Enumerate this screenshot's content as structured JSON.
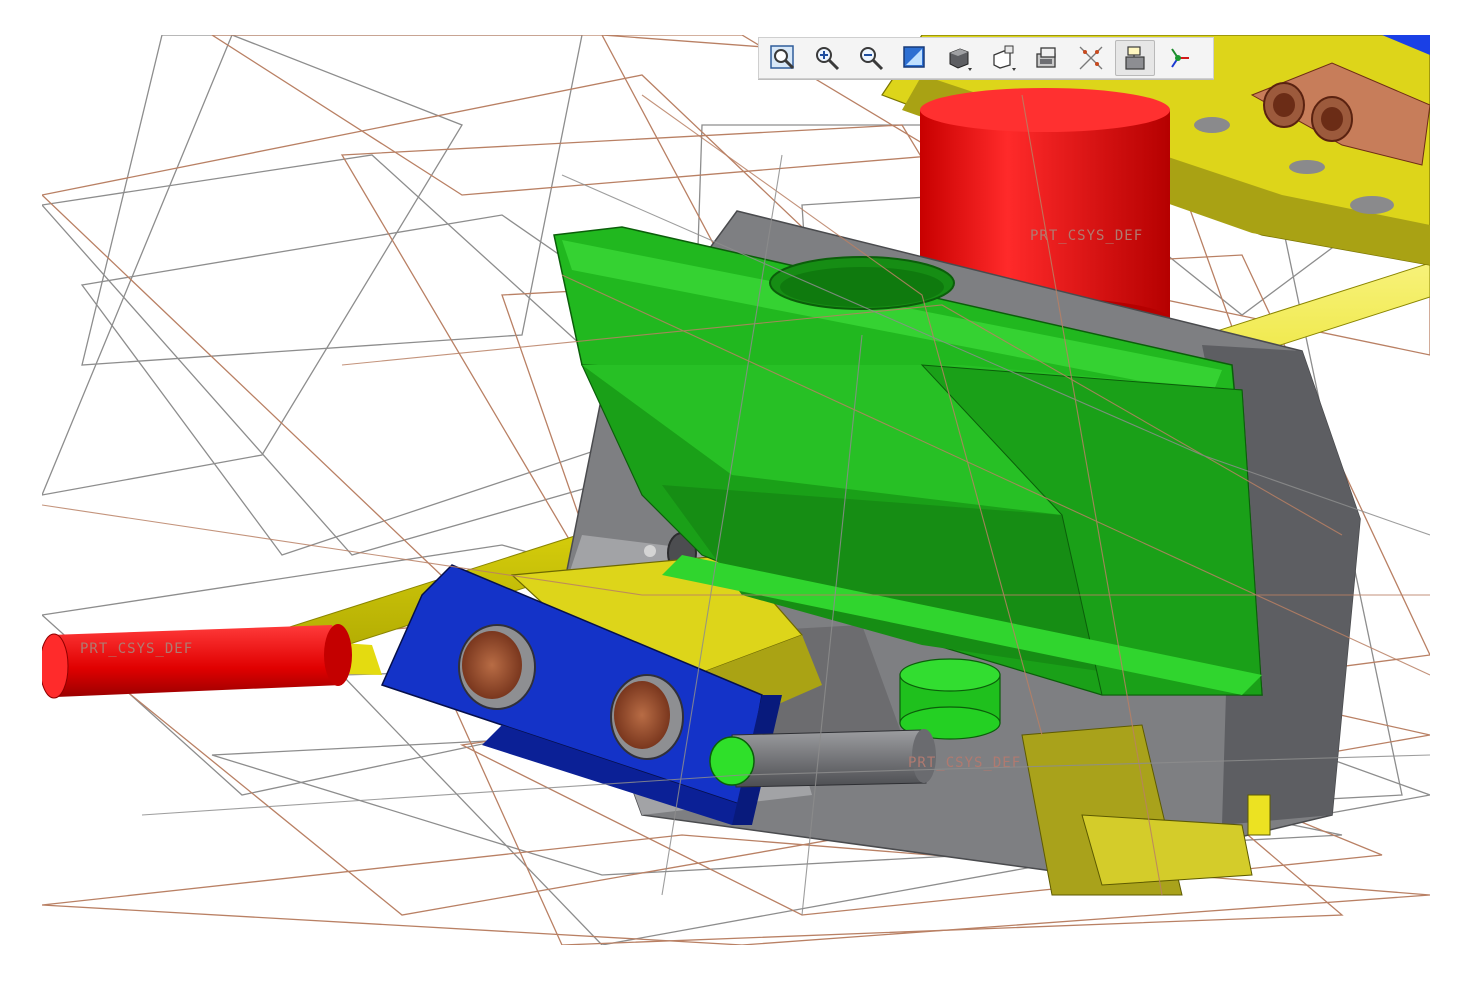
{
  "window": {
    "title": ""
  },
  "viewport": {
    "csys_labels": {
      "cylinder_top": "PRT_CSYS_DEF",
      "cylinder_left": "PRT_CSYS_DEF",
      "pin_bottom": "PRT_CSYS_DEF"
    },
    "colors": {
      "background": "#ffffff",
      "datum_plane_brown": "#b07a60",
      "datum_plane_gray": "#8a8a8a",
      "green_part": "#21b81f",
      "red_part": "#ee1111",
      "yellow_part": "#e8e010",
      "blue_part": "#1433c8",
      "gray_part": "#7e7f82",
      "copper": "#b66a4a"
    }
  },
  "toolbar": {
    "buttons": [
      {
        "name": "refit-view-button",
        "icon": "refit-view-icon"
      },
      {
        "name": "zoom-in-button",
        "icon": "zoom-in-icon"
      },
      {
        "name": "zoom-out-button",
        "icon": "zoom-out-icon"
      },
      {
        "name": "repaint-button",
        "icon": "repaint-icon"
      },
      {
        "name": "display-style-button",
        "icon": "display-style-icon"
      },
      {
        "name": "saved-views-button",
        "icon": "saved-views-icon"
      },
      {
        "name": "view-manager-button",
        "icon": "view-manager-icon"
      },
      {
        "name": "datum-display-button",
        "icon": "datum-display-icon"
      },
      {
        "name": "annotation-display-button",
        "icon": "annotation-display-icon",
        "active": true
      },
      {
        "name": "spin-center-button",
        "icon": "spin-center-icon"
      }
    ]
  }
}
